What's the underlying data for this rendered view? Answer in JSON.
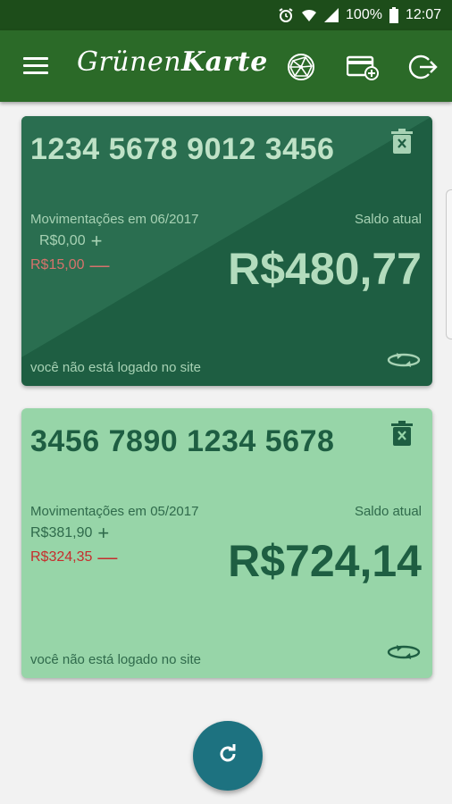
{
  "status_bar": {
    "battery": "100%",
    "time": "12:07",
    "icons": [
      "alarm-icon",
      "wifi-icon",
      "signal-icon",
      "battery-icon"
    ]
  },
  "app_bar": {
    "title_part1": "Grünen",
    "title_part2": "Karte",
    "icons": [
      "menu-icon",
      "network-globe-icon",
      "add-card-icon",
      "logout-icon"
    ]
  },
  "cards": [
    {
      "number": "1234 5678 9012 3456",
      "movements_label": "Movimentações em 06/2017",
      "credit": "R$0,00",
      "credit_sign": "+",
      "debit": "R$15,00",
      "debit_sign": "—",
      "balance_label": "Saldo atual",
      "balance": "R$480,77",
      "login_note": "você não está logado no site",
      "colors": {
        "background": "#1e5e42"
      }
    },
    {
      "number": "3456 7890 1234 5678",
      "movements_label": "Movimentações em 05/2017",
      "credit": "R$381,90",
      "credit_sign": "+",
      "debit": "R$324,35",
      "debit_sign": "—",
      "balance_label": "Saldo atual",
      "balance": "R$724,14",
      "login_note": "você não está logado no site",
      "colors": {
        "background": "#97d5a8"
      }
    }
  ],
  "fab": {
    "icon": "refresh-icon"
  },
  "colors": {
    "app_bar": "#2b6a28",
    "status_bar": "#1d4d1a",
    "fab": "#1d7280"
  }
}
